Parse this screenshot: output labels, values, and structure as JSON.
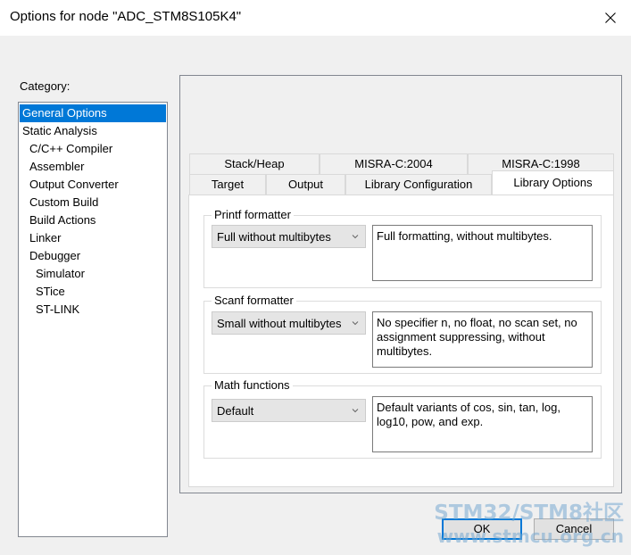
{
  "window": {
    "title": "Options for node \"ADC_STM8S105K4\""
  },
  "category": {
    "label": "Category:",
    "items": [
      {
        "label": "General Options",
        "level": 0,
        "selected": true
      },
      {
        "label": "Static Analysis",
        "level": 0
      },
      {
        "label": "C/C++ Compiler",
        "level": 1
      },
      {
        "label": "Assembler",
        "level": 1
      },
      {
        "label": "Output Converter",
        "level": 1
      },
      {
        "label": "Custom Build",
        "level": 1
      },
      {
        "label": "Build Actions",
        "level": 1
      },
      {
        "label": "Linker",
        "level": 1
      },
      {
        "label": "Debugger",
        "level": 1
      },
      {
        "label": "Simulator",
        "level": 2
      },
      {
        "label": "STice",
        "level": 2
      },
      {
        "label": "ST-LINK",
        "level": 2
      }
    ]
  },
  "tabs": {
    "row1": [
      "Stack/Heap",
      "MISRA-C:2004",
      "MISRA-C:1998"
    ],
    "row2": [
      "Target",
      "Output",
      "Library Configuration",
      "Library Options"
    ],
    "active": "Library Options"
  },
  "printf": {
    "title": "Printf formatter",
    "selected": "Full without multibytes",
    "description": "Full formatting, without multibytes."
  },
  "scanf": {
    "title": "Scanf formatter",
    "selected": "Small without multibytes",
    "description": "No specifier n, no float, no scan set, no assignment suppressing, without multibytes."
  },
  "math": {
    "title": "Math functions",
    "selected": "Default",
    "description": "Default variants of cos, sin, tan, log, log10, pow, and exp."
  },
  "buttons": {
    "ok": "OK",
    "cancel": "Cancel"
  },
  "watermark": {
    "line1": "STM32/STM8社区",
    "line2": "www.stmcu.org.cn"
  },
  "colors": {
    "selection": "#0078d7",
    "window_bg": "#f0f0f0",
    "default_button_border": "#0078d7"
  }
}
